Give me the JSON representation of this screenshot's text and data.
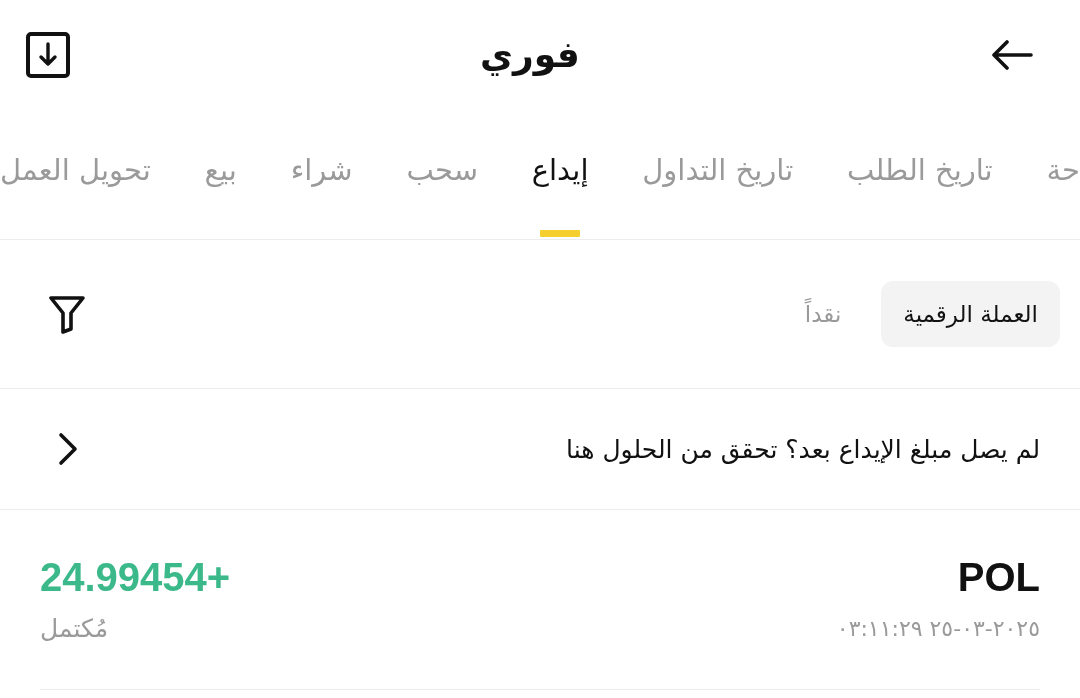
{
  "header": {
    "title": "فوري"
  },
  "tabs": [
    {
      "label": "حة",
      "selected": false
    },
    {
      "label": "تاريخ الطلب",
      "selected": false
    },
    {
      "label": "تاريخ التداول",
      "selected": false
    },
    {
      "label": "إيداع",
      "selected": true
    },
    {
      "label": "سحب",
      "selected": false
    },
    {
      "label": "شراء",
      "selected": false
    },
    {
      "label": "بيع",
      "selected": false
    },
    {
      "label": "تحويل العمل",
      "selected": false
    }
  ],
  "segments": [
    {
      "label": "العملة الرقمية",
      "selected": true
    },
    {
      "label": "نقداً",
      "selected": false
    }
  ],
  "notice": {
    "text": "لم يصل مبلغ الإيداع بعد؟ تحقق من الحلول هنا"
  },
  "transactions": [
    {
      "asset": "POL",
      "datetime": "٢٠٢٥-٠٣-٢٥ ٠٣:١١:٢٩",
      "amount": "24.99454+",
      "status": "مُكتمل"
    }
  ]
}
